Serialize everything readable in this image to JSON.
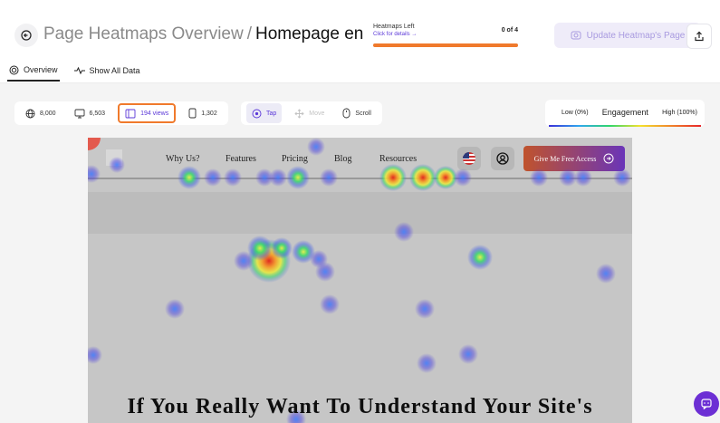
{
  "header": {
    "title_parent": "Page Heatmaps Overview",
    "title_separator": "/",
    "title_current": "Homepage en"
  },
  "heatmaps_left": {
    "label": "Heatmaps Left",
    "details_link": "Click for details →",
    "count": "0 of 4",
    "progress": 1.0,
    "bar_color": "#f07a2c"
  },
  "update_button": {
    "label": "Update Heatmap's Page"
  },
  "tabs": [
    {
      "label": "Overview",
      "icon": "overview-icon",
      "active": true
    },
    {
      "label": "Show All Data",
      "icon": "pulse-icon",
      "active": false
    }
  ],
  "filters": {
    "devices": [
      {
        "label": "8,000",
        "icon": "globe-icon"
      },
      {
        "label": "6,503",
        "icon": "desktop-icon"
      },
      {
        "label": "194 views",
        "icon": "tablet-icon",
        "selected": true
      },
      {
        "label": "1,302",
        "icon": "mobile-icon"
      }
    ],
    "modes": [
      {
        "label": "Tap",
        "icon": "tap-icon",
        "active": true
      },
      {
        "label": "Move",
        "icon": "move-icon",
        "disabled": true
      },
      {
        "label": "Scroll",
        "icon": "mouse-icon"
      }
    ]
  },
  "engagement": {
    "low": "Low (0%)",
    "label": "Engagement",
    "high": "High (100%)"
  },
  "preview": {
    "nav": [
      "Why Us?",
      "Features",
      "Pricing",
      "Blog",
      "Resources"
    ],
    "cta": "Give Me Free Access",
    "hero": "If You Really Want To Understand Your Site's"
  },
  "colors": {
    "accent": "#5b38d8",
    "highlight": "#f07a2c",
    "chat": "#6c2fd4"
  }
}
